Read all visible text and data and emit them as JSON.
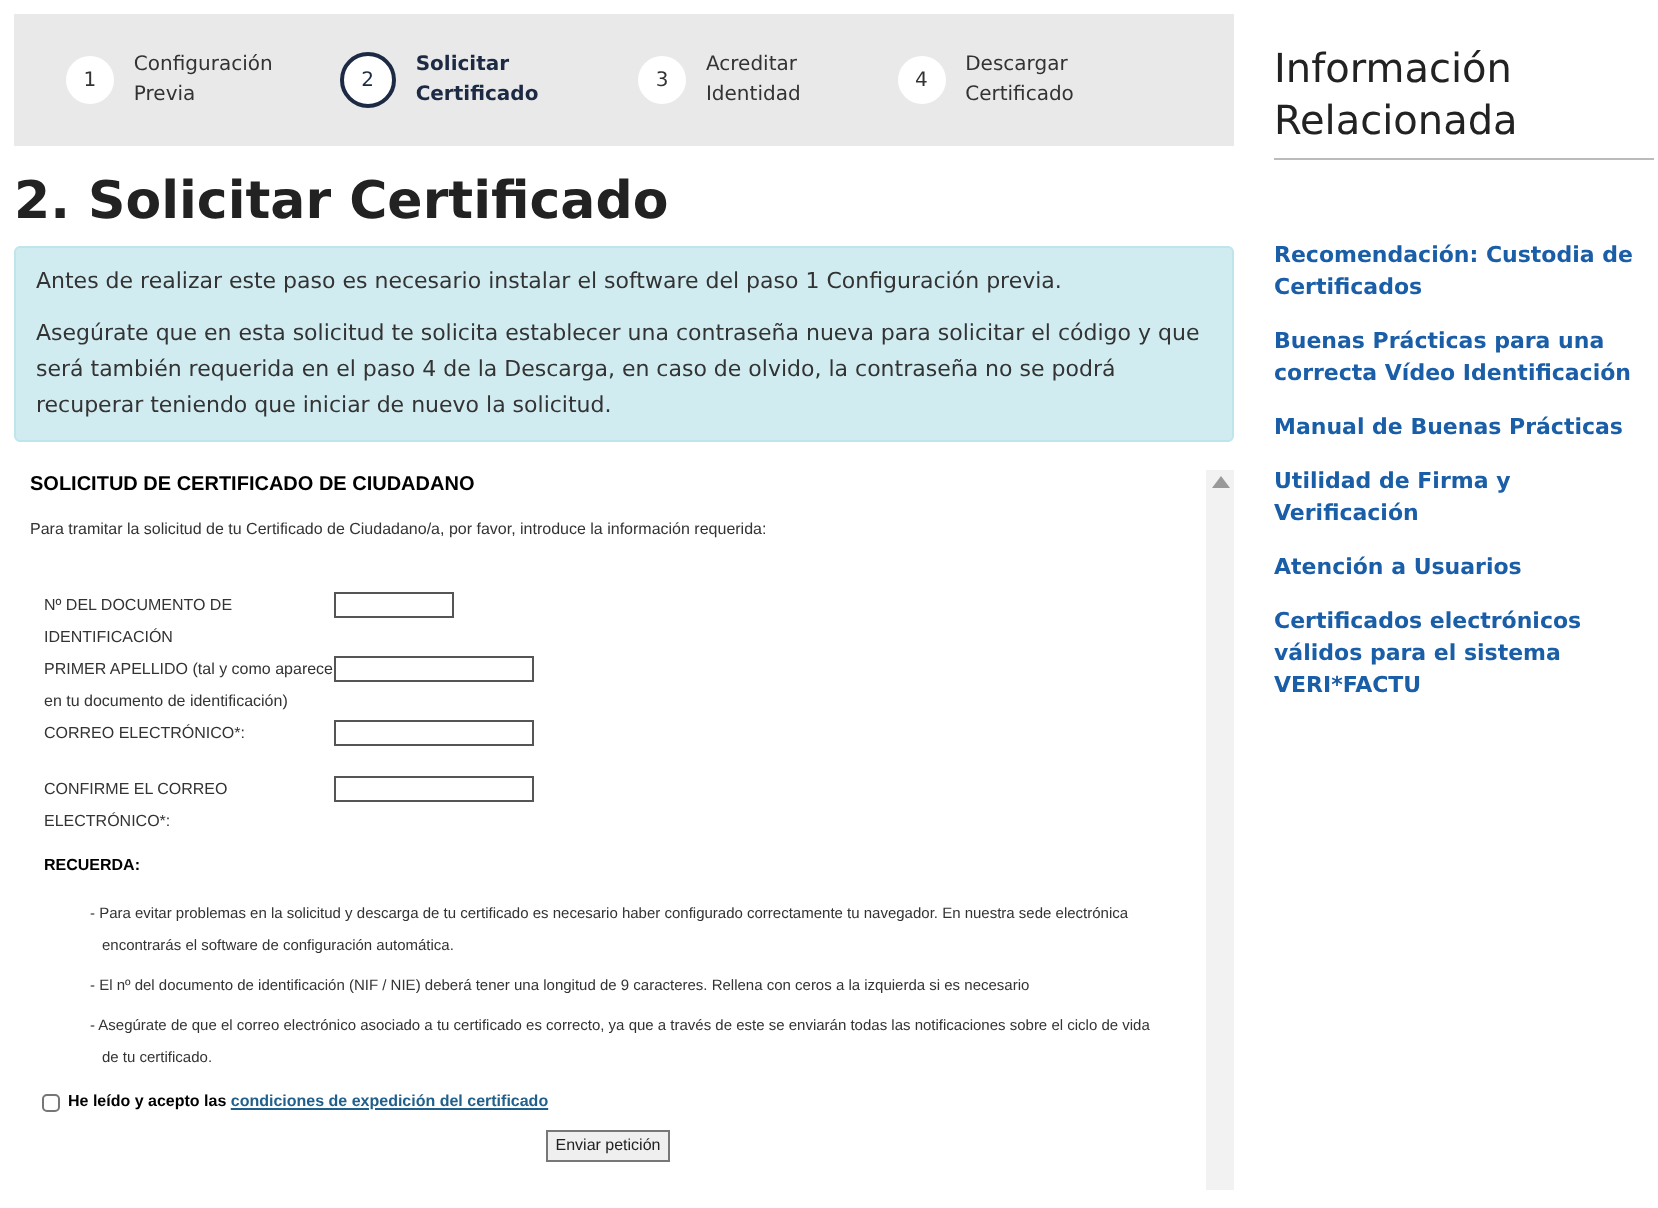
{
  "steps": [
    {
      "number": "1",
      "label": "Configuración Previa",
      "selected": false
    },
    {
      "number": "2",
      "label": "Solicitar Certificado",
      "selected": true
    },
    {
      "number": "3",
      "label": "Acreditar Identidad",
      "selected": false
    },
    {
      "number": "4",
      "label": "Descargar Certificado",
      "selected": false
    }
  ],
  "title": "2. Solicitar Certificado",
  "notice": [
    "Antes de realizar este paso es necesario instalar el software del paso 1 Configuración previa.",
    "Asegúrate que en esta solicitud te solicita establecer una contraseña nueva para solicitar el código y que será también requerida en el paso 4 de la Descarga, en caso de olvido, la contraseña no se podrá recuperar teniendo que iniciar de nuevo la solicitud."
  ],
  "form": {
    "title": "SOLICITUD DE CERTIFICADO DE CIUDADANO",
    "intro": "Para tramitar la solicitud de tu Certificado de Ciudadano/a, por favor, introduce la información requerida:",
    "fields": [
      {
        "label": "Nº DEL DOCUMENTO DE IDENTIFICACIÓN",
        "kind": "short"
      },
      {
        "label": "PRIMER APELLIDO (tal y como aparece en tu documento de identificación)",
        "kind": "long"
      },
      {
        "label": "CORREO ELECTRÓNICO*:",
        "kind": "long"
      },
      {
        "label": "CONFIRME EL CORREO ELECTRÓNICO*:",
        "kind": "long"
      }
    ],
    "remember_title": "RECUERDA:",
    "remember_items": [
      "- Para evitar problemas en la solicitud y descarga de tu certificado es necesario haber configurado correctamente tu navegador. En nuestra sede electrónica encontrarás el software de configuración automática.",
      "- El nº del documento de identificación (NIF / NIE) deberá tener una longitud de 9 caracteres. Rellena con ceros a la izquierda si es necesario",
      "- Asegúrate de que el correo electrónico asociado a tu certificado es correcto, ya que a través de este se enviarán todas las notificaciones sobre el ciclo de vida de tu certificado."
    ],
    "consent": {
      "checked": false,
      "label": "He leído y acepto las",
      "link": "condiciones de expedición del certificado"
    },
    "submit": "Enviar petición"
  },
  "sidebar": {
    "title": "Información Relacionada",
    "links": [
      "Recomendación: Custodia de Certificados",
      "Buenas Prácticas para una correcta Vídeo Identificación",
      "Manual de Buenas Prácticas",
      "Utilidad de Firma y Verificación",
      "Atención a Usuarios",
      "Certificados electrónicos válidos para el sistema VERI*FACTU"
    ]
  }
}
